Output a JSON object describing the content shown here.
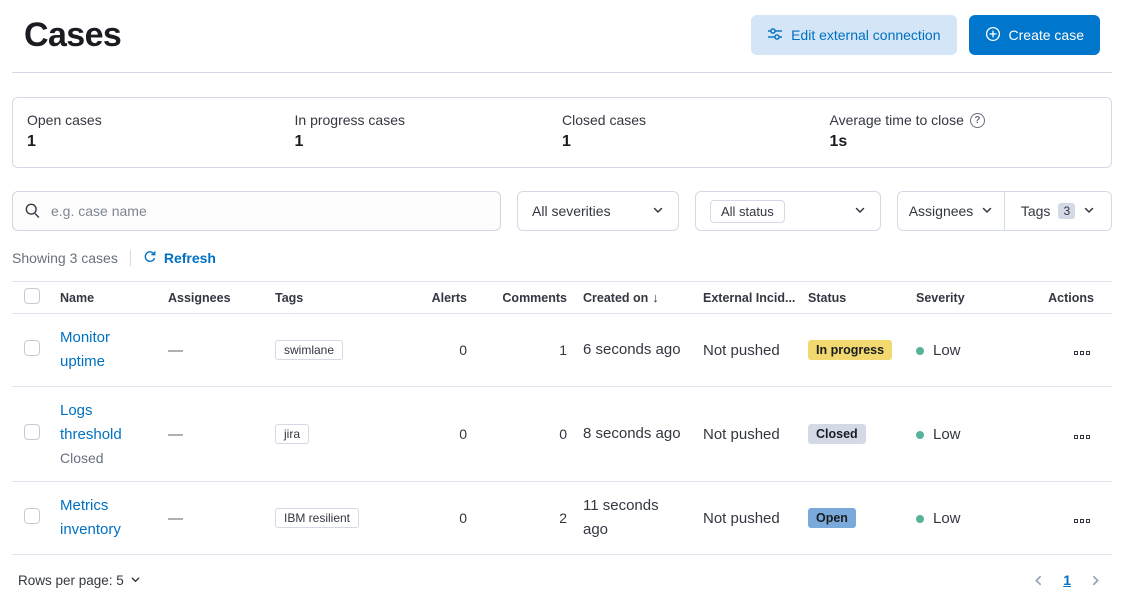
{
  "header": {
    "title": "Cases",
    "edit_connection_label": "Edit external connection",
    "create_case_label": "Create case"
  },
  "stats": {
    "open": {
      "label": "Open cases",
      "value": "1"
    },
    "in_progress": {
      "label": "In progress cases",
      "value": "1"
    },
    "closed": {
      "label": "Closed cases",
      "value": "1"
    },
    "avg_close": {
      "label": "Average time to close",
      "value": "1s"
    }
  },
  "filters": {
    "search_placeholder": "e.g. case name",
    "severities_label": "All severities",
    "status_label": "All status",
    "assignees_label": "Assignees",
    "tags_label": "Tags",
    "tags_count": "3"
  },
  "results": {
    "showing_text": "Showing 3 cases",
    "refresh_label": "Refresh"
  },
  "table": {
    "columns": [
      "Name",
      "Assignees",
      "Tags",
      "Alerts",
      "Comments",
      "Created on",
      "External Incid...",
      "Status",
      "Severity",
      "Actions"
    ],
    "rows": [
      {
        "name": "Monitor uptime",
        "subtitle": "",
        "assignees": "—",
        "tag": "swimlane",
        "alerts": "0",
        "comments": "1",
        "created": "6 seconds ago",
        "external": "Not pushed",
        "status": "In progress",
        "severity": "Low"
      },
      {
        "name": "Logs threshold",
        "subtitle": "Closed",
        "assignees": "—",
        "tag": "jira",
        "alerts": "0",
        "comments": "0",
        "created": "8 seconds ago",
        "external": "Not pushed",
        "status": "Closed",
        "severity": "Low"
      },
      {
        "name": "Metrics inventory",
        "subtitle": "",
        "assignees": "—",
        "tag": "IBM resilient",
        "alerts": "0",
        "comments": "2",
        "created": "11 seconds ago",
        "external": "Not pushed",
        "status": "Open",
        "severity": "Low"
      }
    ]
  },
  "pagination": {
    "rows_per_page_label": "Rows per page: 5",
    "current_page": "1"
  },
  "icons": {
    "sort_desc": "↓",
    "info": "?"
  },
  "colors": {
    "primary_button": "#0077cc",
    "link": "#0071c2",
    "light_button_bg": "#d3e5f6",
    "badge_in_progress": "#f1d86f",
    "badge_closed": "#d3dae6",
    "badge_open": "#79aad9",
    "severity_low_dot": "#54b399",
    "border": "#d3dae6"
  }
}
